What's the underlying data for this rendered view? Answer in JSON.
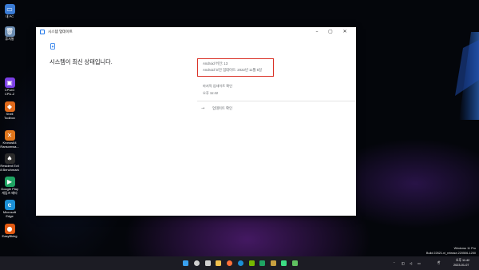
{
  "desktop": {
    "icons": [
      {
        "label": "내 PC",
        "color": "#3a7bd5",
        "glyph": "▭"
      },
      {
        "label": "휴지통",
        "color": "#6a8bb0",
        "glyph": "🗑"
      },
      {
        "label": "CPUID\nCPU-Z",
        "color": "#7b3fe4",
        "glyph": "▣"
      },
      {
        "label": "Shell\nToolbox",
        "color": "#e06a1b",
        "glyph": "◆"
      },
      {
        "label": "Kronos64\nRansomwa...",
        "color": "#e0761b",
        "glyph": "✕"
      },
      {
        "label": "Resident Evil\n8 Benchmark",
        "color": "#2b2b2b",
        "glyph": "♠"
      },
      {
        "label": "Google Play\n게임즈 베타",
        "color": "#1fa463",
        "glyph": "▶"
      },
      {
        "label": "Microsoft\nEdge",
        "color": "#1b8fd6",
        "glyph": "e"
      },
      {
        "label": "EasyBking",
        "color": "#e25a12",
        "glyph": "●"
      }
    ]
  },
  "window": {
    "title": "시스템 업데이트"
  },
  "content": {
    "status_message": "시스템이 최신 상태입니다.",
    "android_version": "Android 버전: 13",
    "security_update": "Android 보안 업데이트: 2022년 11월 5일",
    "last_checked_label": "마지막 업데이트 확인",
    "last_checked_time": "오후 11:42",
    "check_update_label": "업데이트 확인"
  },
  "taskbar": {
    "icons": [
      {
        "name": "start-icon",
        "color": "#3aa0f0"
      },
      {
        "name": "search-icon",
        "color": "#cfcfcf"
      },
      {
        "name": "task-view-icon",
        "color": "#d0d0d0"
      },
      {
        "name": "file-explorer-icon",
        "color": "#f2c14e"
      },
      {
        "name": "firefox-icon",
        "color": "#ff7139"
      },
      {
        "name": "edge-icon",
        "color": "#1b8fd6"
      },
      {
        "name": "nvidia-icon",
        "color": "#76b900"
      },
      {
        "name": "google-play-games-icon",
        "color": "#1fa463"
      },
      {
        "name": "app-icon",
        "color": "#c8a040"
      },
      {
        "name": "android-icon",
        "color": "#3ddc84"
      },
      {
        "name": "phone-icon",
        "color": "#5fc060"
      }
    ],
    "tray_language": "한",
    "clock_time": "오후 11:42",
    "clock_date": "2023-01-07"
  },
  "watermark": {
    "line1": "Windows 11 Pro",
    "line2": "Build 22621.ni_release.220506-1250"
  }
}
